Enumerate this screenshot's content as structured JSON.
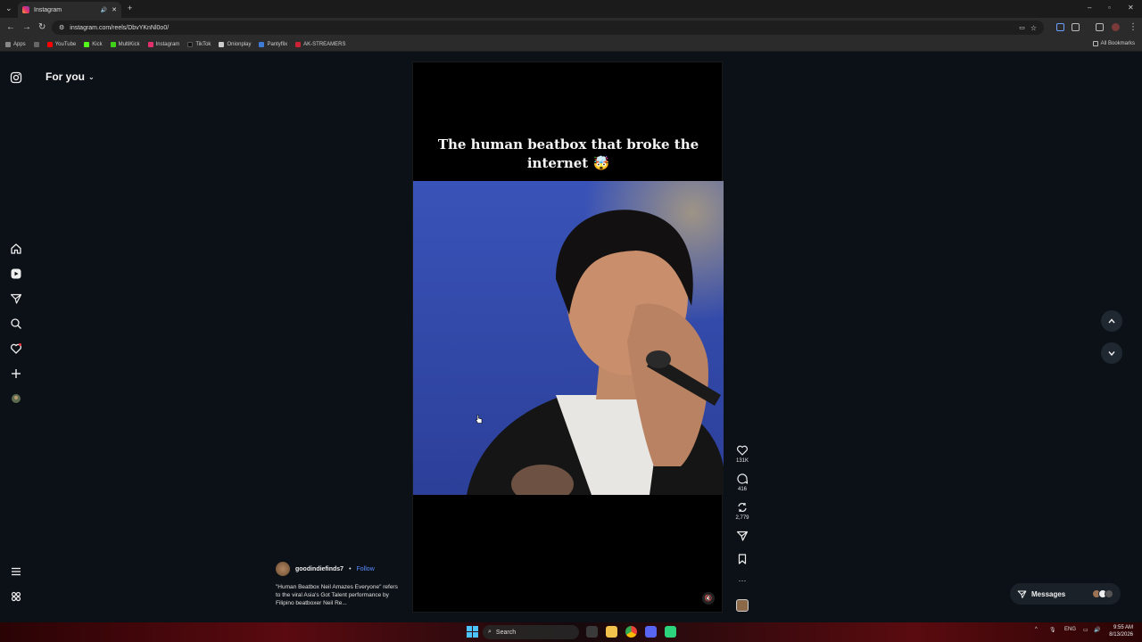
{
  "browser": {
    "tab_title": "Instagram",
    "url": "instagram.com/reels/DbvYKnNl0o0/",
    "bookmarks": [
      "Apps",
      "YouTube",
      "Kick",
      "MultiKick",
      "Instagram",
      "TikTok",
      "Onionplay",
      "Pantyflix",
      "AK-STREAMERS"
    ],
    "all_bookmarks": "All Bookmarks"
  },
  "header": {
    "feed_label": "For you"
  },
  "reel": {
    "overlay_caption": "The human beatbox that broke the internet 🤯",
    "author": "goodindiefinds7",
    "separator": "•",
    "follow": "Follow",
    "description": "\"Human Beatbox Neil Amazes Everyone\" refers to the viral Asia's Got Talent performance by Filipino beatboxer Neil Re...",
    "likes": "131K",
    "comments": "416",
    "reposts": "2,779",
    "more": "···"
  },
  "messages": {
    "label": "Messages"
  },
  "taskbar": {
    "search": "Search",
    "lang": "ENG",
    "time": "9:55 AM",
    "date": "8/13/2026"
  },
  "icons": [
    "instagram-icon",
    "home-icon",
    "reels-icon",
    "direct-icon",
    "search-icon",
    "heart-icon",
    "plus-icon",
    "profile-icon",
    "menu-icon",
    "threads-icon"
  ]
}
